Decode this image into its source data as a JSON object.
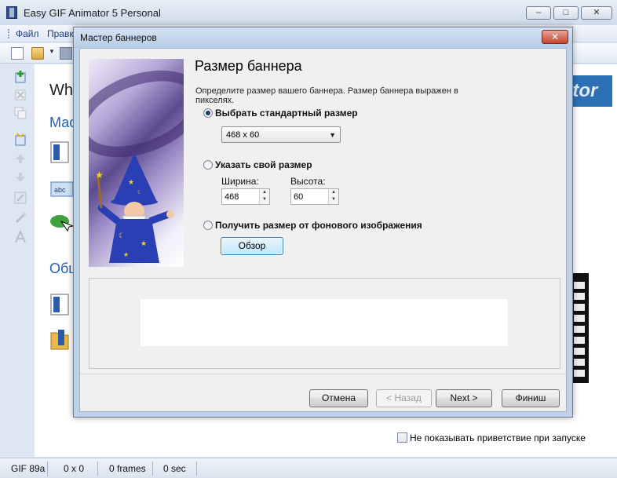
{
  "app": {
    "title": "Easy GIF Animator 5 Personal",
    "window_buttons": [
      "–",
      "□",
      "✕"
    ]
  },
  "menu": {
    "items": [
      "Файл",
      "Правк"
    ]
  },
  "workspace": {
    "welcome_partial": "Wh",
    "section1_partial": "Мас",
    "section2_partial": "Общ",
    "banner_right_partial": "ator",
    "show_on_start_label": "Не показывать приветствие при запуске"
  },
  "status": {
    "format": "GIF 89a",
    "size": "0 x 0",
    "frames": "0 frames",
    "time": "0 sec"
  },
  "dialog": {
    "title": "Мастер баннеров",
    "close_glyph": "✕",
    "heading": "Размер баннера",
    "description": "Определите размер вашего баннера. Размер баннера выражен в пикселях.",
    "option_standard": "Выбрать стандартный размер",
    "standard_value": "468 x 60",
    "option_custom": "Указать свой размер",
    "width_label": "Ширина:",
    "width_value": "468",
    "height_label": "Высота:",
    "height_value": "60",
    "option_from_image": "Получить размер от фонового изображения",
    "browse_label": "Обзор",
    "buttons": {
      "cancel": "Отмена",
      "back": "< Назад",
      "next": "Next >",
      "finish": "Финиш"
    },
    "selected_option": "standard"
  }
}
